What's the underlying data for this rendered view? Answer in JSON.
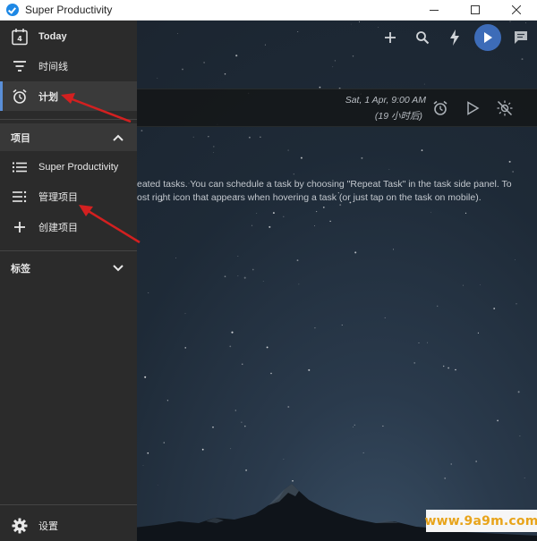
{
  "window": {
    "title": "Super Productivity"
  },
  "sidebar": {
    "items": [
      {
        "label": "Today",
        "icon": "today-calendar-icon"
      },
      {
        "label": "时间线",
        "icon": "timeline-icon"
      },
      {
        "label": "计划",
        "icon": "alarm-icon"
      }
    ],
    "projects_section": {
      "label": "项目",
      "expanded": true
    },
    "projects": [
      {
        "label": "Super Productivity",
        "icon": "list-icon"
      },
      {
        "label": "管理项目",
        "icon": "manage-list-icon"
      },
      {
        "label": "创建项目",
        "icon": "plus-icon"
      }
    ],
    "tags_section": {
      "label": "标签",
      "expanded": false
    },
    "settings": {
      "label": "设置",
      "icon": "gear-icon"
    }
  },
  "today_icon_number": "4",
  "task": {
    "date": "Sat, 1 Apr, 9:00 AM",
    "relative": "(19 小时后)"
  },
  "help": {
    "line1": "eated tasks. You can schedule a task by choosing \"Repeat Task\" in the task side panel. To",
    "line2": "ost right icon that appears when hovering a task (or just tap on the task on mobile)."
  },
  "watermark": "www.9a9m.com",
  "colors": {
    "accent": "#3d6cb8",
    "annotation": "#d32020",
    "sidebar_bg": "#2b2b2b"
  }
}
